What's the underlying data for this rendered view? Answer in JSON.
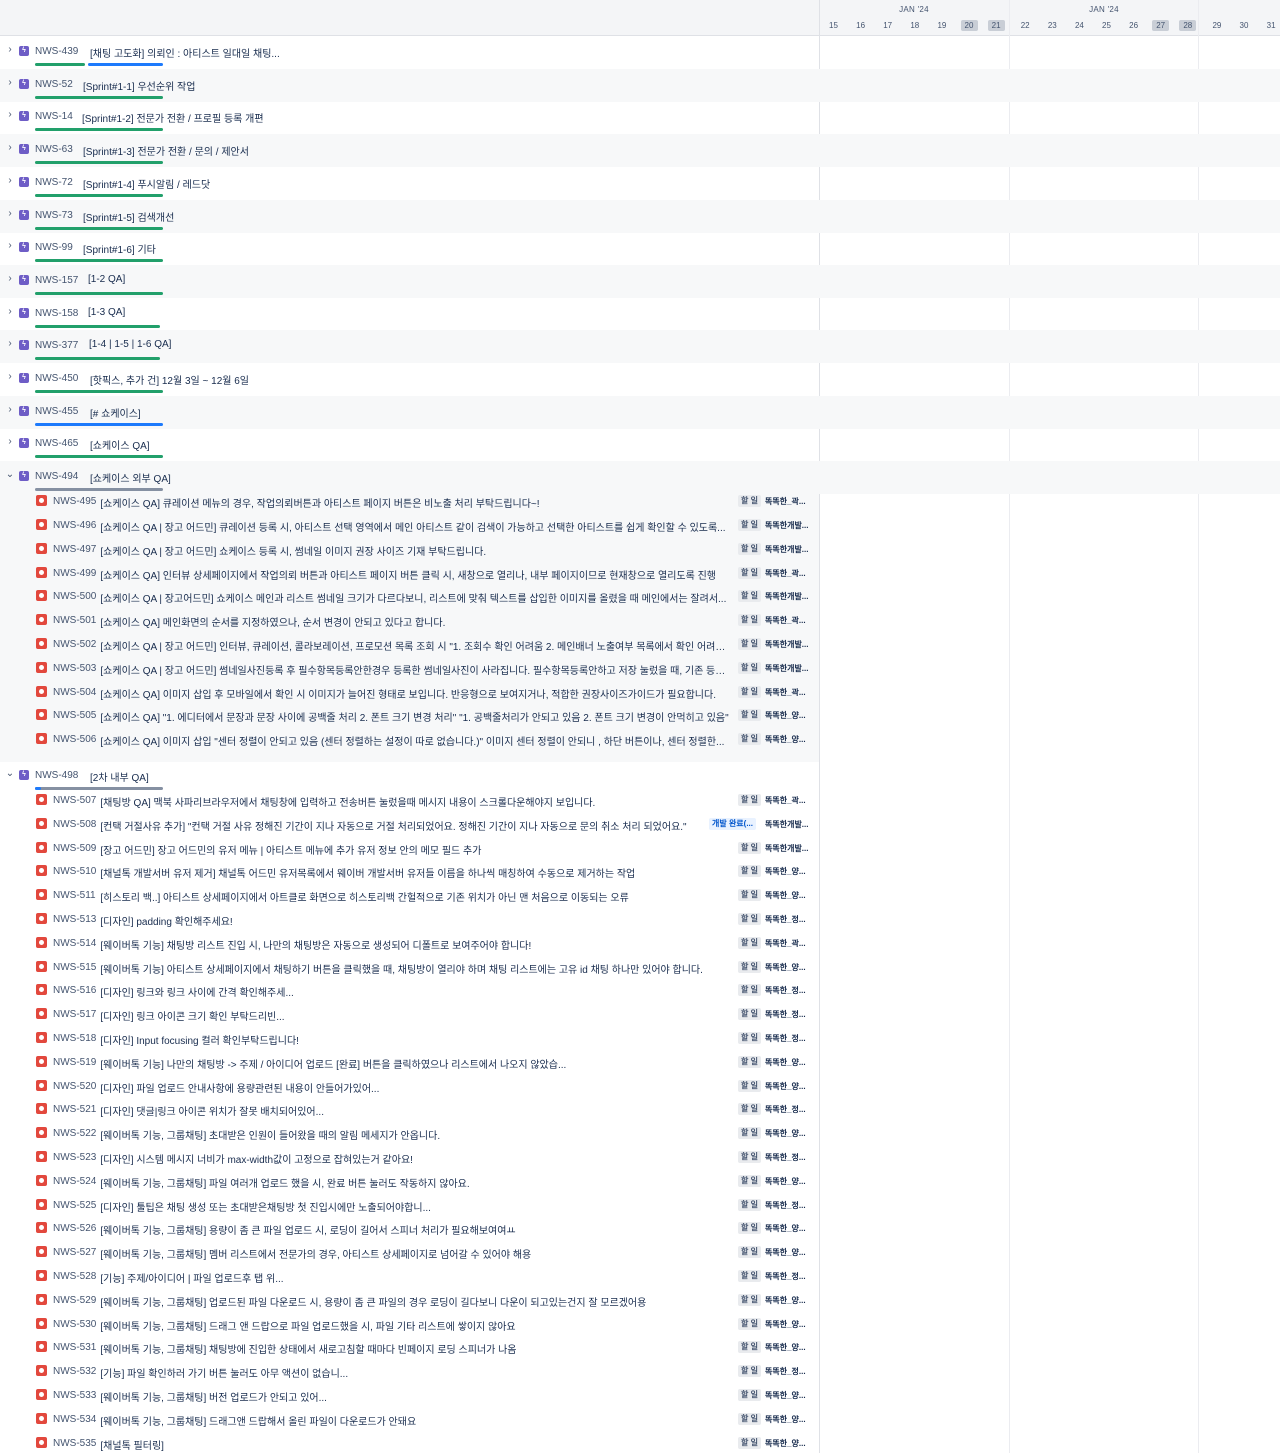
{
  "timeline": {
    "months": [
      "JAN '24",
      "JAN '24"
    ],
    "days": [
      "15",
      "16",
      "17",
      "18",
      "19",
      "20",
      "21",
      "22",
      "23",
      "24",
      "25",
      "26",
      "27",
      "28",
      "29",
      "30",
      "31"
    ],
    "weekend_days": [
      "20",
      "21",
      "27",
      "28"
    ]
  },
  "epics": [
    {
      "key": "NWS-439",
      "title": "[채팅 고도화] 의뢰인 : 아티스트 일대일 채팅...",
      "expanded": false
    },
    {
      "key": "NWS-52",
      "title": "[Sprint#1-1] 우선순위 작업",
      "expanded": false
    },
    {
      "key": "NWS-14",
      "title": "[Sprint#1-2] 전문가 전환 / 프로필 등록 개편",
      "expanded": false
    },
    {
      "key": "NWS-63",
      "title": "[Sprint#1-3] 전문가 전환 / 문의 / 제안서",
      "expanded": false
    },
    {
      "key": "NWS-72",
      "title": "[Sprint#1-4] 푸시알림 / 레드닷",
      "expanded": false
    },
    {
      "key": "NWS-73",
      "title": "[Sprint#1-5] 검색개선",
      "expanded": false
    },
    {
      "key": "NWS-99",
      "title": "[Sprint#1-6] 기타",
      "expanded": false
    },
    {
      "key": "NWS-157",
      "title": "[1-2 QA]",
      "expanded": false
    },
    {
      "key": "NWS-158",
      "title": "[1-3 QA]",
      "expanded": false
    },
    {
      "key": "NWS-377",
      "title": "[1-4 | 1-5 | 1-6 QA]",
      "expanded": false
    },
    {
      "key": "NWS-450",
      "title": "[핫픽스, 추가 건] 12월 3일 ~ 12월 6일",
      "expanded": false
    },
    {
      "key": "NWS-455",
      "title": "[# 쇼케이스]",
      "expanded": false
    },
    {
      "key": "NWS-465",
      "title": "[쇼케이스 QA]",
      "expanded": false
    },
    {
      "key": "NWS-494",
      "title": "[쇼케이스 외부 QA]",
      "expanded": true
    },
    {
      "key": "NWS-498",
      "title": "[2차 내부 QA]",
      "expanded": true
    }
  ],
  "group_494": [
    {
      "key": "NWS-495",
      "title": "[쇼케이스 QA] 큐레이션 메뉴의 경우, 작업의뢰버튼과 아티스트 페이지 버튼은 비노출 처리 부탁드립니다~!",
      "status": "할 일",
      "assignee": "똑똑한_곽..."
    },
    {
      "key": "NWS-496",
      "title": "[쇼케이스 QA | 장고 어드민] 큐레이션 등록 시, 아티스트 선택 영역에서 메인 아티스트 같이 검색이 가능하고 선택한 아티스트를 쉽게 확인할 수 있도록...",
      "status": "할 일",
      "assignee": "똑똑한개발..."
    },
    {
      "key": "NWS-497",
      "title": "[쇼케이스 QA | 장고 어드민] 쇼케이스 등록 시, 썸네일 이미지 권장 사이즈 기재 부탁드립니다.",
      "status": "할 일",
      "assignee": "똑똑한개발..."
    },
    {
      "key": "NWS-499",
      "title": "[쇼케이스 QA] 인터뷰 상세페이지에서 작업의뢰 버튼과 아티스트 페이지 버튼 클릭 시, 새창으로 열리나, 내부 페이지이므로 현재창으로 열리도록 진행",
      "status": "할 일",
      "assignee": "똑똑한_곽..."
    },
    {
      "key": "NWS-500",
      "title": "[쇼케이스 QA | 장고어드민] 쇼케이스 메인과 리스트 썸네일 크기가 다르다보니, 리스트에 맞춰 텍스트를 삽입한 이미지를 올렸을 때 메인에서는 잘려서...",
      "status": "할 일",
      "assignee": "똑똑한개발..."
    },
    {
      "key": "NWS-501",
      "title": "[쇼케이스 QA] 메인화면의 순서를 지정하였으나, 순서 변경이 안되고 있다고 합니다.",
      "status": "할 일",
      "assignee": "똑똑한_곽..."
    },
    {
      "key": "NWS-502",
      "title": "[쇼케이스 QA | 장고 어드민] 인터뷰, 큐레이션, 콜라보레이션, 프로모션 목록 조회 시 \"1. 조회수 확인 어려움 2. 메인배너 노출여부 목록에서 확인 어려움...",
      "status": "할 일",
      "assignee": "똑똑한개발..."
    },
    {
      "key": "NWS-503",
      "title": "[쇼케이스 QA | 장고 어드민] 썸네일사진등록 후 필수항목등록안한경우 등록한 썸네일사진이 사라집니다. 필수항목등록안하고 저장 눌렀을 때, 기존 등록...",
      "status": "할 일",
      "assignee": "똑똑한개발..."
    },
    {
      "key": "NWS-504",
      "title": "[쇼케이스 QA] 이미지 삽입 후 모바일에서 확인 시 이미지가 늘어진 형태로 보입니다. 반응형으로 보여지거나, 적합한 권장사이즈가이드가 필요합니다.",
      "status": "할 일",
      "assignee": "똑똑한_곽..."
    },
    {
      "key": "NWS-505",
      "title": "[쇼케이스 QA] \"1. 에디터에서 문장과 문장 사이에 공백줄 처리 2. 폰트 크기 변경 처리\" \"1. 공백줄처리가 안되고 있음 2. 폰트 크기 변경이 안먹히고 있음\"",
      "status": "할 일",
      "assignee": "똑똑한_양..."
    },
    {
      "key": "NWS-506",
      "title": "[쇼케이스 QA] 이미지 삽입 \"센터 정렬이 안되고 있음 (센터 정렬하는 설정이 따로 없습니다.)\"  이미지 센터 정렬이 안되니 , 하단 버튼이나, 센터 정렬한...",
      "status": "할 일",
      "assignee": "똑똑한_양..."
    }
  ],
  "group_498": [
    {
      "key": "NWS-507",
      "title": "[채팅방 QA] 맥북 사파리브라우저에서 채팅창에 입력하고 전송버튼 눌렀을때 메시지 내용이 스크롤다운해야지 보입니다.",
      "status": "할 일",
      "assignee": "똑똑한_곽..."
    },
    {
      "key": "NWS-508",
      "title": "[컨택 거절사유 추가] \"컨택 거절 사유 정해진 기간이 지나 자동으로 거절 처리되었어요. 정해진 기간이 지나 자동으로 문의 취소 처리 되었어요.\"",
      "status": "개발 완료(...",
      "assignee": "똑똑한개발..."
    },
    {
      "key": "NWS-509",
      "title": "[장고 어드민] 장고 어드민의 유저 메뉴 | 아티스트 메뉴에 추가 유저 정보 안의 메모 필드 추가",
      "status": "할 일",
      "assignee": "똑똑한개발..."
    },
    {
      "key": "NWS-510",
      "title": "[채널톡 개발서버 유저 제거] 채널톡 어드민 유저목록에서 웨이버 개발서버 유저들 이름을 하나씩 매칭하여 수동으로 제거하는 작업",
      "status": "할 일",
      "assignee": "똑똑한_양..."
    },
    {
      "key": "NWS-511",
      "title": "[히스토리 백..] 아티스트 상세페이지에서 아트클로 화면으로 히스토리백 간헐적으로 기존 위치가 아닌 맨 처음으로 이동되는 오류",
      "status": "할 일",
      "assignee": "똑똑한_양..."
    },
    {
      "key": "NWS-513",
      "title": "[디자인] padding 확인해주세요!",
      "status": "할 일",
      "assignee": "똑똑한_정..."
    },
    {
      "key": "NWS-514",
      "title": "[웨이버톡 기능] 채팅방 리스트 진입 시, 나만의 채팅방은 자동으로 생성되어 디폴트로 보여주어야 합니다!",
      "status": "할 일",
      "assignee": "똑똑한_곽..."
    },
    {
      "key": "NWS-515",
      "title": "[웨이버톡 기능] 아티스트 상세페이지에서 채팅하기 버튼을 클릭했을 때, 채팅방이 열리야 하며 채팅 리스트에는 고유 id 채팅 하나만 있어야 합니다.",
      "status": "할 일",
      "assignee": "똑똑한_양..."
    },
    {
      "key": "NWS-516",
      "title": "[디자인] 링크와 링크 사이에 간격 확인해주세...",
      "status": "할 일",
      "assignee": "똑똑한_정..."
    },
    {
      "key": "NWS-517",
      "title": "[디자인] 링크 아이콘 크기 확인 부탁드리빈...",
      "status": "할 일",
      "assignee": "똑똑한_정..."
    },
    {
      "key": "NWS-518",
      "title": "[디자인] Input focusing 컬러 확인부탁드립니다!",
      "status": "할 일",
      "assignee": "똑똑한_정..."
    },
    {
      "key": "NWS-519",
      "title": "[웨이버톡 기능] 나만의 채팅방 -> 주제 / 아이디어 업로드 [완료] 버튼을 클릭하였으나 리스트에서 나오지 않았습...",
      "status": "할 일",
      "assignee": "똑똑한_양..."
    },
    {
      "key": "NWS-520",
      "title": "[디자인] 파일 업로드 안내사항에 용량관련된 내용이 안들어가있어...",
      "status": "할 일",
      "assignee": "똑똑한_양..."
    },
    {
      "key": "NWS-521",
      "title": "[디자인] 댓글|링크 아이콘 위치가 잘못 배치되어있어...",
      "status": "할 일",
      "assignee": "똑똑한_정..."
    },
    {
      "key": "NWS-522",
      "title": "[웨이버톡 기능, 그룹채팅] 초대받은 인원이 들어왔을 때의 알림 메세지가 안옵니다.",
      "status": "할 일",
      "assignee": "똑똑한_양..."
    },
    {
      "key": "NWS-523",
      "title": "[디자인] 시스템 메시지 너비가 max-width값이 고정으로 잡혀있는거 같아요!",
      "status": "할 일",
      "assignee": "똑똑한_정..."
    },
    {
      "key": "NWS-524",
      "title": "[웨이버톡 기능, 그룹채팅] 파일 여러개 업로드 했을 시, 완료 버튼 눌러도 작동하지 않아요.",
      "status": "할 일",
      "assignee": "똑똑한_양..."
    },
    {
      "key": "NWS-525",
      "title": "[디자인] 툴팁은 채팅 생성 또는 초대받은채팅방 첫 진입시에만 노출되어야합니...",
      "status": "할 일",
      "assignee": "똑똑한_정..."
    },
    {
      "key": "NWS-526",
      "title": "[웨이버톡 기능, 그룹채팅] 용량이 좀 큰 파일 업로드 시, 로딩이 길어서 스피너 처리가 필요해보여여ㅛ",
      "status": "할 일",
      "assignee": "똑똑한_양..."
    },
    {
      "key": "NWS-527",
      "title": "[웨이버톡 기능, 그룹채팅] 멤버 리스트에서 전문가의 경우, 아티스트 상세페이지로 넘어갈 수 있어야 해용",
      "status": "할 일",
      "assignee": "똑똑한_양..."
    },
    {
      "key": "NWS-528",
      "title": "[기능] 주제/아이디어 | 파일 업로드후 탭 위...",
      "status": "할 일",
      "assignee": "똑똑한_정..."
    },
    {
      "key": "NWS-529",
      "title": "[웨이버톡 기능, 그룹채팅] 업로드된 파일 다운로드 시, 용량이 좀 큰 파일의 경우 로딩이 길다보니 다운이 되고있는건지 잘 모르겠어용",
      "status": "할 일",
      "assignee": "똑똑한_양..."
    },
    {
      "key": "NWS-530",
      "title": "[웨이버톡 기능, 그룹채팅] 드래그 앤 드랍으로 파일 업로드했을 시, 파일 기타 리스트에 쌓이지 않아요",
      "status": "할 일",
      "assignee": "똑똑한_양..."
    },
    {
      "key": "NWS-531",
      "title": "[웨이버톡 기능, 그룹채팅] 채팅방에 진입한 상태에서 새로고침할 때마다 빈페이지 로딩 스피너가 나옴",
      "status": "할 일",
      "assignee": "똑똑한_양..."
    },
    {
      "key": "NWS-532",
      "title": "[기능] 파일 확인하러 가기 버튼 눌러도 아무 액션이 없습니...",
      "status": "할 일",
      "assignee": "똑똑한_정..."
    },
    {
      "key": "NWS-533",
      "title": "[웨이버톡 기능, 그룹채팅] 버전 업로드가 안되고 있어...",
      "status": "할 일",
      "assignee": "똑똑한_양..."
    },
    {
      "key": "NWS-534",
      "title": "[웨이버톡 기능, 그룹채팅] 드래그앤 드랍해서 올린 파일이 다운로드가 안돼요",
      "status": "할 일",
      "assignee": "똑똑한_양..."
    },
    {
      "key": "NWS-535",
      "title": "[채널톡 필터링]",
      "status": "할 일",
      "assignee": "똑똑한_양..."
    }
  ],
  "colors": {
    "epic": "#6e5dc6",
    "bug": "#e2483d",
    "progress_done": "#22a06b",
    "progress_in_progress": "#1d7afc"
  }
}
